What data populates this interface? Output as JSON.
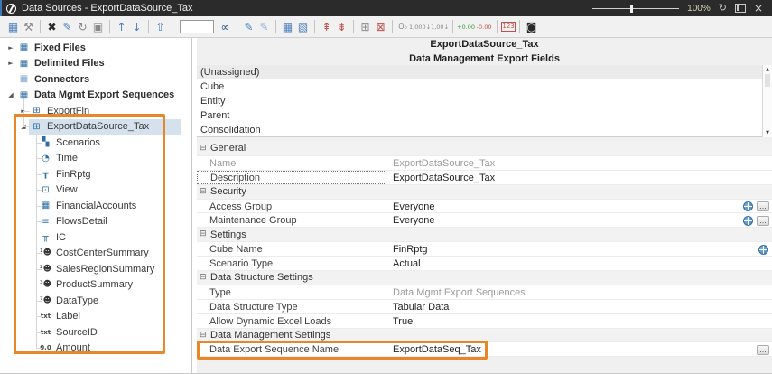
{
  "titlebar": {
    "title": "Data Sources - ExportDataSource_Tax",
    "zoom_value": "100%",
    "refresh_glyph": "↻",
    "close_glyph": "×"
  },
  "toolbar": {
    "search_value": "",
    "items": [
      {
        "name": "new-datasource-icon",
        "glyph": "▦"
      },
      {
        "name": "connection-tools-icon",
        "glyph": "⚒"
      },
      {
        "name": "delete-icon",
        "glyph": "✖"
      },
      {
        "name": "edit-icon",
        "glyph": "✎"
      },
      {
        "name": "refresh-icon",
        "glyph": "↻"
      },
      {
        "name": "save-icon",
        "glyph": "▣"
      },
      {
        "name": "move-up-icon",
        "glyph": "↑"
      },
      {
        "name": "move-down-icon",
        "glyph": "↓"
      },
      {
        "name": "load-file-icon",
        "glyph": "⇧"
      },
      {
        "name": "find-icon",
        "glyph": "∞"
      },
      {
        "name": "edit-transform-icon",
        "glyph": "✎"
      },
      {
        "name": "edit-parse-icon",
        "glyph": "✎"
      },
      {
        "name": "grid-view-icon",
        "glyph": "▦"
      },
      {
        "name": "grid-transform-icon",
        "glyph": "▧"
      },
      {
        "name": "field-up-icon",
        "glyph": "⇞"
      },
      {
        "name": "field-down-icon",
        "glyph": "⇟"
      },
      {
        "name": "number-grid-icon",
        "glyph": "⊞"
      },
      {
        "name": "number-grid-clear-icon",
        "glyph": "⊠"
      },
      {
        "name": "suppress-zeros-icon",
        "glyph": "O₀"
      },
      {
        "name": "thousands-separator-icon",
        "glyph": "1,000↓"
      },
      {
        "name": "hundreds-separator-icon",
        "glyph": "1,00↓"
      },
      {
        "name": "add-decimal-icon",
        "glyph": "+0.00"
      },
      {
        "name": "remove-decimal-icon",
        "glyph": "-0.00"
      },
      {
        "name": "number-format-icon",
        "glyph": "123"
      },
      {
        "name": "export-data-icon",
        "glyph": "◙"
      }
    ]
  },
  "tree": {
    "items": [
      {
        "label": "Fixed Files",
        "expander": "►",
        "glyph": "▦"
      },
      {
        "label": "Delimited Files",
        "expander": "►",
        "glyph": "▦"
      },
      {
        "label": "Connectors",
        "expander": "",
        "glyph": "▦"
      },
      {
        "label": "Data Mgmt Export Sequences",
        "expander": "◢",
        "glyph": "▦"
      },
      {
        "label": "ExportFin",
        "expander": "►",
        "glyph": "⊞"
      },
      {
        "label": "ExportDataSource_Tax",
        "expander": "◢",
        "glyph": "⊞"
      },
      {
        "label": "Scenarios",
        "expander": "",
        "glyph": "▚"
      },
      {
        "label": "Time",
        "expander": "",
        "glyph": "◔"
      },
      {
        "label": "FinRptg",
        "expander": "",
        "glyph": "┳"
      },
      {
        "label": "View",
        "expander": "",
        "glyph": "⊡"
      },
      {
        "label": "FinancialAccounts",
        "expander": "",
        "glyph": "▦"
      },
      {
        "label": "FlowsDetail",
        "expander": "",
        "glyph": "≡"
      },
      {
        "label": "IC",
        "expander": "",
        "glyph": "╥"
      },
      {
        "label": "CostCenterSummary",
        "expander": "",
        "glyph": "¹☻"
      },
      {
        "label": "SalesRegionSummary",
        "expander": "",
        "glyph": "²☻"
      },
      {
        "label": "ProductSummary",
        "expander": "",
        "glyph": "³☻"
      },
      {
        "label": "DataType",
        "expander": "",
        "glyph": "⁷☻"
      },
      {
        "label": "Label",
        "expander": "",
        "glyph": "txt"
      },
      {
        "label": "SourceID",
        "expander": "",
        "glyph": "txt"
      },
      {
        "label": "Amount",
        "expander": "",
        "glyph": "0.0"
      }
    ]
  },
  "fields_panel": {
    "title": "ExportDataSource_Tax",
    "subtitle": "Data Management Export Fields",
    "rows": [
      "(Unassigned)",
      "Cube",
      "Entity",
      "Parent",
      "Consolidation"
    ],
    "scroll_up_glyph": "▲",
    "scroll_down_glyph": "▼"
  },
  "properties": {
    "section_glyph": "⊟",
    "ellipsis": "…",
    "rows": [
      {
        "kind": "section",
        "label": "General"
      },
      {
        "kind": "prop",
        "label": "Name",
        "value": "ExportDataSource_Tax"
      },
      {
        "kind": "prop",
        "label": "Description",
        "value": "ExportDataSource_Tax"
      },
      {
        "kind": "section",
        "label": "Security"
      },
      {
        "kind": "prop",
        "label": "Access Group",
        "value": "Everyone"
      },
      {
        "kind": "prop",
        "label": "Maintenance Group",
        "value": "Everyone"
      },
      {
        "kind": "section",
        "label": "Settings"
      },
      {
        "kind": "prop",
        "label": "Cube Name",
        "value": "FinRptg"
      },
      {
        "kind": "prop",
        "label": "Scenario Type",
        "value": "Actual"
      },
      {
        "kind": "section",
        "label": "Data Structure Settings"
      },
      {
        "kind": "prop",
        "label": "Type",
        "value": "Data Mgmt Export Sequences"
      },
      {
        "kind": "prop",
        "label": "Data Structure Type",
        "value": "Tabular Data"
      },
      {
        "kind": "prop",
        "label": "Allow Dynamic Excel Loads",
        "value": "True"
      },
      {
        "kind": "section",
        "label": "Data Management Settings"
      },
      {
        "kind": "prop",
        "label": "Data Export Sequence Name",
        "value": "ExportDataSeq_Tax"
      }
    ],
    "highlight_color": "#e8872a"
  }
}
